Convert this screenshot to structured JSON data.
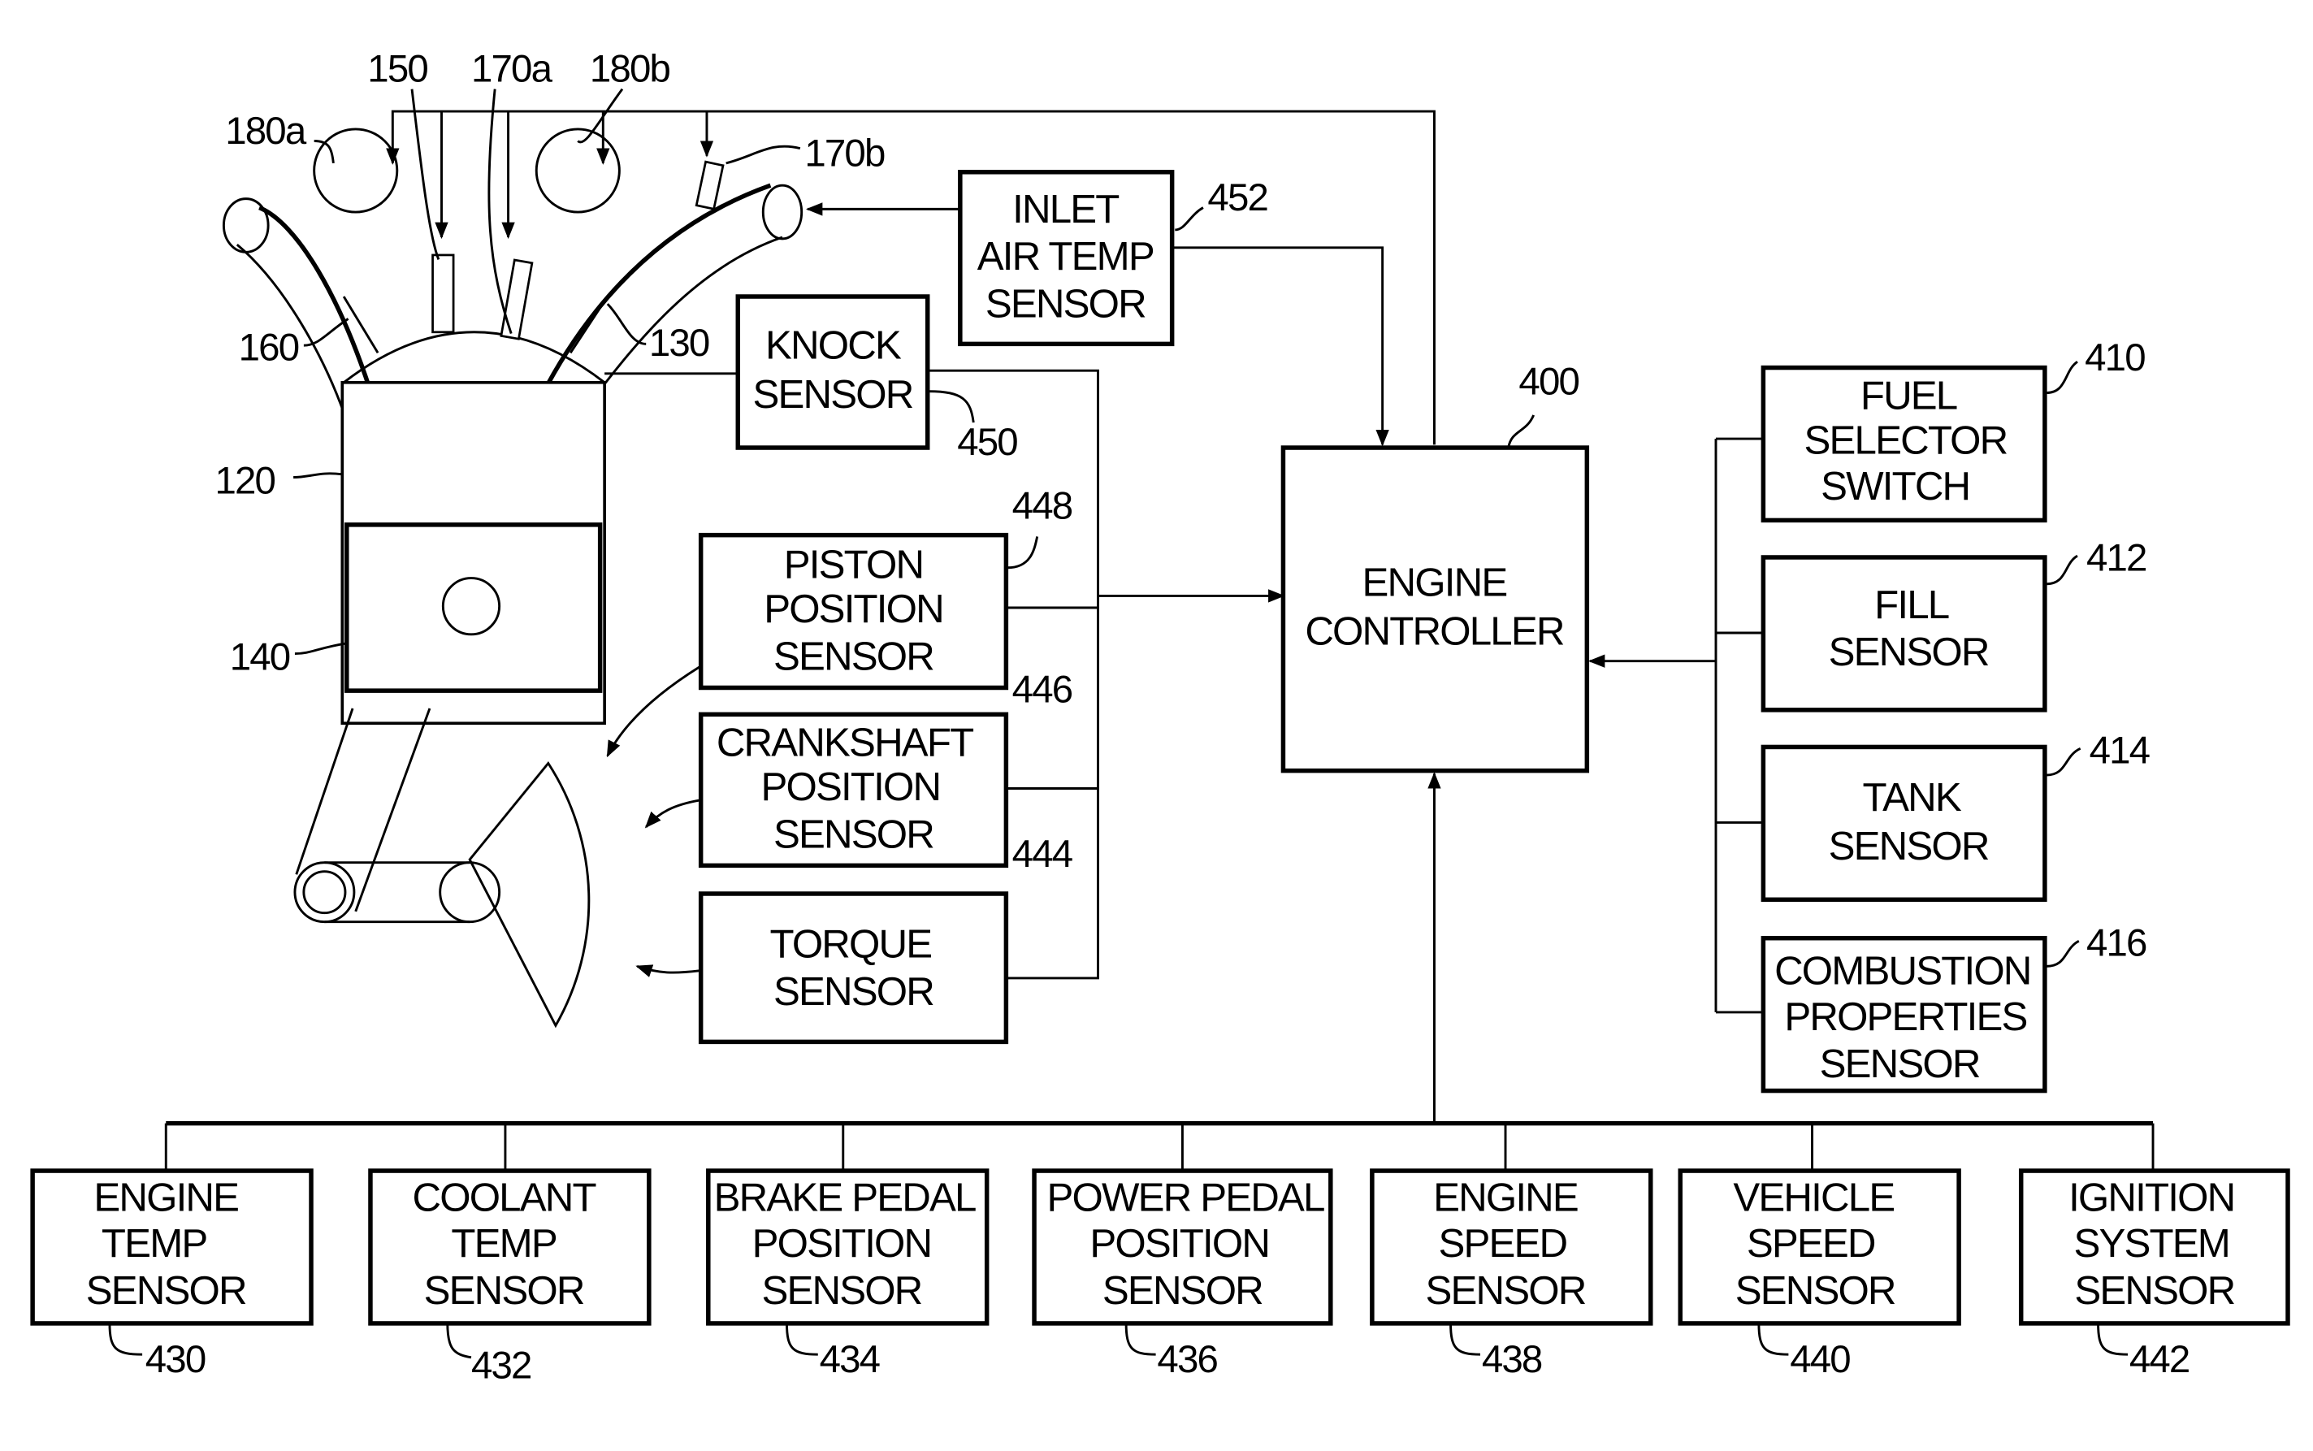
{
  "figure": {
    "controller": {
      "ref": "400",
      "lines": [
        "ENGINE",
        "CONTROLLER"
      ]
    },
    "right_sensors": [
      {
        "ref": "410",
        "lines": [
          "FUEL",
          "SELECTOR",
          "SWITCH"
        ]
      },
      {
        "ref": "412",
        "lines": [
          "FILL",
          "SENSOR"
        ]
      },
      {
        "ref": "414",
        "lines": [
          "TANK",
          "SENSOR"
        ]
      },
      {
        "ref": "416",
        "lines": [
          "COMBUSTION",
          "PROPERTIES",
          "SENSOR"
        ]
      }
    ],
    "bottom_sensors": [
      {
        "ref": "430",
        "lines": [
          "ENGINE",
          "TEMP",
          "SENSOR"
        ]
      },
      {
        "ref": "432",
        "lines": [
          "COOLANT",
          "TEMP",
          "SENSOR"
        ]
      },
      {
        "ref": "434",
        "lines": [
          "BRAKE PEDAL",
          "POSITION",
          "SENSOR"
        ]
      },
      {
        "ref": "436",
        "lines": [
          "POWER PEDAL",
          "POSITION",
          "SENSOR"
        ]
      },
      {
        "ref": "438",
        "lines": [
          "ENGINE",
          "SPEED",
          "SENSOR"
        ]
      },
      {
        "ref": "440",
        "lines": [
          "VEHICLE",
          "SPEED",
          "SENSOR"
        ]
      },
      {
        "ref": "442",
        "lines": [
          "IGNITION",
          "SYSTEM",
          "SENSOR"
        ]
      }
    ],
    "engine_sensors": [
      {
        "ref": "452",
        "lines": [
          "INLET",
          "AIR TEMP",
          "SENSOR"
        ]
      },
      {
        "ref": "450",
        "lines": [
          "KNOCK",
          "SENSOR"
        ]
      },
      {
        "ref": "448",
        "lines": [
          "PISTON",
          "POSITION",
          "SENSOR"
        ]
      },
      {
        "ref": "446",
        "lines": [
          "CRANKSHAFT",
          "POSITION",
          "SENSOR"
        ]
      },
      {
        "ref": "444",
        "lines": [
          "TORQUE",
          "SENSOR"
        ]
      }
    ],
    "engine_labels": {
      "l150": "150",
      "l170a": "170a",
      "l180b": "180b",
      "l180a": "180a",
      "l170b": "170b",
      "l160": "160",
      "l130": "130",
      "l120": "120",
      "l140": "140"
    }
  }
}
